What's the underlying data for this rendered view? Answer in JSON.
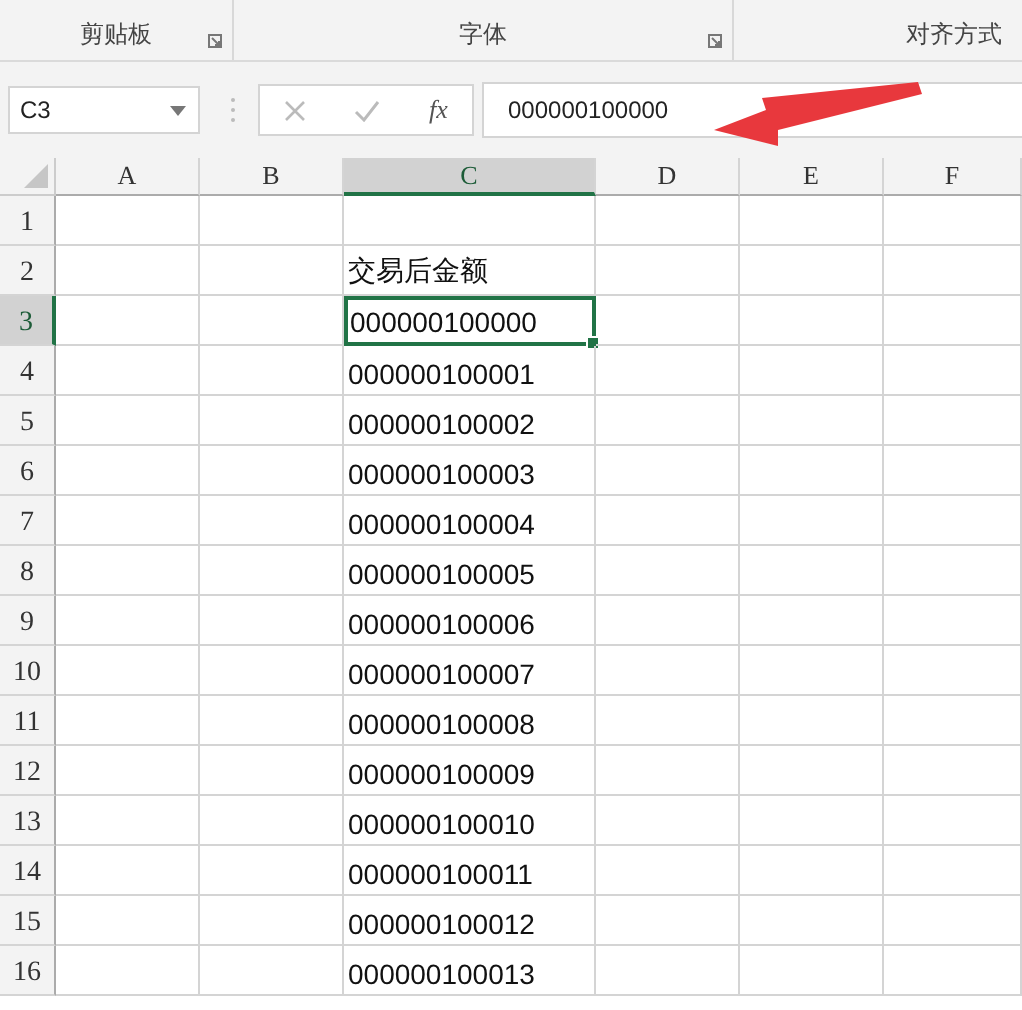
{
  "ribbon_groups": [
    {
      "label": "剪贴板",
      "launcher": true
    },
    {
      "label": "字体",
      "launcher": true
    },
    {
      "label": "对齐方式",
      "launcher": false
    }
  ],
  "formula_bar": {
    "name_box": "C3",
    "formula": "000000100000",
    "function_button": "fx",
    "annotation_arrow": true
  },
  "columns": [
    {
      "label": "A",
      "selected": false
    },
    {
      "label": "B",
      "selected": false
    },
    {
      "label": "C",
      "selected": true
    },
    {
      "label": "D",
      "selected": false
    },
    {
      "label": "E",
      "selected": false
    },
    {
      "label": "F",
      "selected": false
    }
  ],
  "rows": [
    {
      "label": "1",
      "selected": false,
      "cells": [
        "",
        "",
        "",
        "",
        "",
        ""
      ]
    },
    {
      "label": "2",
      "selected": false,
      "cells": [
        "",
        "",
        "交易后金额",
        "",
        "",
        ""
      ]
    },
    {
      "label": "3",
      "selected": true,
      "cells": [
        "",
        "",
        "000000100000",
        "",
        "",
        ""
      ]
    },
    {
      "label": "4",
      "selected": false,
      "cells": [
        "",
        "",
        "000000100001",
        "",
        "",
        ""
      ]
    },
    {
      "label": "5",
      "selected": false,
      "cells": [
        "",
        "",
        "000000100002",
        "",
        "",
        ""
      ]
    },
    {
      "label": "6",
      "selected": false,
      "cells": [
        "",
        "",
        "000000100003",
        "",
        "",
        ""
      ]
    },
    {
      "label": "7",
      "selected": false,
      "cells": [
        "",
        "",
        "000000100004",
        "",
        "",
        ""
      ]
    },
    {
      "label": "8",
      "selected": false,
      "cells": [
        "",
        "",
        "000000100005",
        "",
        "",
        ""
      ]
    },
    {
      "label": "9",
      "selected": false,
      "cells": [
        "",
        "",
        "000000100006",
        "",
        "",
        ""
      ]
    },
    {
      "label": "10",
      "selected": false,
      "cells": [
        "",
        "",
        "000000100007",
        "",
        "",
        ""
      ]
    },
    {
      "label": "11",
      "selected": false,
      "cells": [
        "",
        "",
        "000000100008",
        "",
        "",
        ""
      ]
    },
    {
      "label": "12",
      "selected": false,
      "cells": [
        "",
        "",
        "000000100009",
        "",
        "",
        ""
      ]
    },
    {
      "label": "13",
      "selected": false,
      "cells": [
        "",
        "",
        "000000100010",
        "",
        "",
        ""
      ]
    },
    {
      "label": "14",
      "selected": false,
      "cells": [
        "",
        "",
        "000000100011",
        "",
        "",
        ""
      ]
    },
    {
      "label": "15",
      "selected": false,
      "cells": [
        "",
        "",
        "000000100012",
        "",
        "",
        ""
      ]
    },
    {
      "label": "16",
      "selected": false,
      "cells": [
        "",
        "",
        "000000100013",
        "",
        "",
        ""
      ]
    }
  ]
}
